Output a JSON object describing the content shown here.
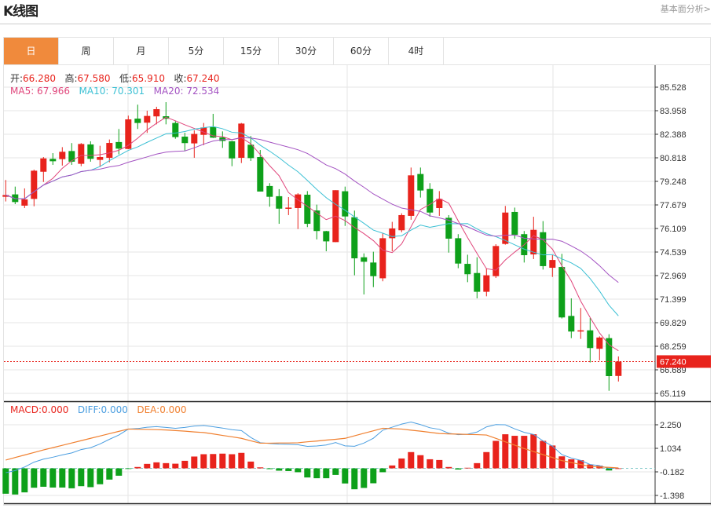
{
  "header": {
    "title": "K线图",
    "link": "基本面分析>"
  },
  "tabs": [
    {
      "label": "日",
      "active": true
    },
    {
      "label": "周"
    },
    {
      "label": "月"
    },
    {
      "label": "5分"
    },
    {
      "label": "15分"
    },
    {
      "label": "30分"
    },
    {
      "label": "60分"
    },
    {
      "label": "4时"
    }
  ],
  "ohlc_legend": {
    "open_label": "开:",
    "open": "66.280",
    "high_label": "高:",
    "high": "67.580",
    "low_label": "低:",
    "low": "65.910",
    "close_label": "收:",
    "close": "67.240"
  },
  "ma_legend": {
    "ma5": "MA5: 67.966",
    "ma10": "MA10: 70.301",
    "ma20": "MA20: 72.534"
  },
  "macd_legend": {
    "macd": "MACD:0.000",
    "diff": "DIFF:0.000",
    "dea": "DEA:0.000"
  },
  "colors": {
    "up": "#e8231c",
    "down": "#0ea01a",
    "ma5": "#e0457b",
    "ma10": "#3cc0d4",
    "ma20": "#a352c2",
    "diff": "#4b9ee0",
    "dea": "#f08030",
    "accent": "#f08a3c"
  },
  "chart_data": [
    {
      "type": "candlestick",
      "price_ticks": [
        "85.528",
        "83.958",
        "82.388",
        "80.818",
        "79.248",
        "77.679",
        "76.109",
        "74.539",
        "72.969",
        "71.399",
        "69.829",
        "68.259",
        "66.689",
        "65.119"
      ],
      "ylim": [
        65.119,
        85.528
      ],
      "current_price": "67.240",
      "candles": [
        [
          78.22,
          79.34,
          77.91,
          78.34
        ],
        [
          78.38,
          78.9,
          77.73,
          77.87
        ],
        [
          77.63,
          78.78,
          77.47,
          78.05
        ],
        [
          78.08,
          80.03,
          77.59,
          79.96
        ],
        [
          79.89,
          80.87,
          79.21,
          80.78
        ],
        [
          80.75,
          81.13,
          80.35,
          80.59
        ],
        [
          80.73,
          81.53,
          80.3,
          81.22
        ],
        [
          81.27,
          81.8,
          80.35,
          80.56
        ],
        [
          80.42,
          81.8,
          80.26,
          81.74
        ],
        [
          81.71,
          81.92,
          80.56,
          80.75
        ],
        [
          80.68,
          81.62,
          80.21,
          80.87
        ],
        [
          80.82,
          82.04,
          80.52,
          81.81
        ],
        [
          81.87,
          82.74,
          81.05,
          81.43
        ],
        [
          81.41,
          83.63,
          81.39,
          83.38
        ],
        [
          83.43,
          84.36,
          82.74,
          83.14
        ],
        [
          83.16,
          83.96,
          82.48,
          83.61
        ],
        [
          83.58,
          84.22,
          83.05,
          84.06
        ],
        [
          83.59,
          84.53,
          83.05,
          83.42
        ],
        [
          83.14,
          83.26,
          82.09,
          82.2
        ],
        [
          82.23,
          82.49,
          81.27,
          81.8
        ],
        [
          81.78,
          82.65,
          80.82,
          82.41
        ],
        [
          82.35,
          83.14,
          81.66,
          82.84
        ],
        [
          82.86,
          83.75,
          82.14,
          82.16
        ],
        [
          82.18,
          82.58,
          81.48,
          81.94
        ],
        [
          81.92,
          81.95,
          80.26,
          80.78
        ],
        [
          80.82,
          83.14,
          80.47,
          83.1
        ],
        [
          81.69,
          82.27,
          80.61,
          80.8
        ],
        [
          80.87,
          81.34,
          78.57,
          78.57
        ],
        [
          78.94,
          79.13,
          77.56,
          78.22
        ],
        [
          78.26,
          78.73,
          76.42,
          77.43
        ],
        [
          77.42,
          78.2,
          77.0,
          77.5
        ],
        [
          77.47,
          78.46,
          76.07,
          78.38
        ],
        [
          78.36,
          78.6,
          76.2,
          76.42
        ],
        [
          77.31,
          77.7,
          75.38,
          75.94
        ],
        [
          75.93,
          75.95,
          74.59,
          75.25
        ],
        [
          75.2,
          78.66,
          75.2,
          78.66
        ],
        [
          78.59,
          78.9,
          76.28,
          76.91
        ],
        [
          76.86,
          77.3,
          72.99,
          74.12
        ],
        [
          74.19,
          74.45,
          71.71,
          73.89
        ],
        [
          73.84,
          74.56,
          72.2,
          72.93
        ],
        [
          72.79,
          75.81,
          72.59,
          75.46
        ],
        [
          75.46,
          76.55,
          74.59,
          76.11
        ],
        [
          75.99,
          77.12,
          75.86,
          77.0
        ],
        [
          76.95,
          80.17,
          76.69,
          79.65
        ],
        [
          79.74,
          80.17,
          78.17,
          78.64
        ],
        [
          78.74,
          79.13,
          76.89,
          77.17
        ],
        [
          77.47,
          78.6,
          76.95,
          78.08
        ],
        [
          76.82,
          77.0,
          74.5,
          75.43
        ],
        [
          75.46,
          75.73,
          73.46,
          73.77
        ],
        [
          73.75,
          74.36,
          72.53,
          73.06
        ],
        [
          73.14,
          74.19,
          71.45,
          71.89
        ],
        [
          71.89,
          73.46,
          71.59,
          72.99
        ],
        [
          72.93,
          75.06,
          72.81,
          74.94
        ],
        [
          75.08,
          77.61,
          75.03,
          77.17
        ],
        [
          77.21,
          77.5,
          75.43,
          75.69
        ],
        [
          75.73,
          75.94,
          73.84,
          74.33
        ],
        [
          74.38,
          76.89,
          74.07,
          76.02
        ],
        [
          75.86,
          76.6,
          73.37,
          73.6
        ],
        [
          73.49,
          74.33,
          72.88,
          74.01
        ],
        [
          73.54,
          74.42,
          70.11,
          70.18
        ],
        [
          70.28,
          71.45,
          68.8,
          69.24
        ],
        [
          69.24,
          70.81,
          68.75,
          69.32
        ],
        [
          69.32,
          70.14,
          67.18,
          68.14
        ],
        [
          68.09,
          68.92,
          67.32,
          68.84
        ],
        [
          68.8,
          69.06,
          65.29,
          66.27
        ],
        [
          66.28,
          67.58,
          65.91,
          67.24
        ]
      ],
      "moving_averages": [
        5,
        10,
        20
      ]
    },
    {
      "type": "macd",
      "ticks": [
        "2.250",
        "1.034",
        "-0.182",
        "-1.398"
      ],
      "ylim": [
        -1.398,
        2.25
      ],
      "macd": [
        -1.31,
        -1.35,
        -1.24,
        -1.0,
        -0.95,
        -0.99,
        -0.99,
        -1.03,
        -0.92,
        -0.97,
        -0.82,
        -0.58,
        -0.38,
        -0.01,
        0.07,
        0.23,
        0.31,
        0.27,
        0.24,
        0.39,
        0.61,
        0.73,
        0.74,
        0.76,
        0.73,
        0.8,
        0.35,
        0.05,
        -0.04,
        -0.12,
        -0.14,
        -0.2,
        -0.47,
        -0.51,
        -0.51,
        -0.34,
        -0.78,
        -1.08,
        -1.01,
        -0.77,
        -0.2,
        0.15,
        0.51,
        0.84,
        0.68,
        0.47,
        0.43,
        0.07,
        -0.06,
        0.03,
        0.27,
        0.84,
        1.42,
        1.76,
        1.68,
        1.68,
        1.76,
        1.42,
        1.18,
        0.62,
        0.47,
        0.42,
        0.2,
        0.14,
        -0.11,
        0.0
      ],
      "dea": [
        0.43,
        0.56,
        0.69,
        0.82,
        0.95,
        1.07,
        1.19,
        1.31,
        1.43,
        1.55,
        1.67,
        1.79,
        1.91,
        2.03,
        2.02,
        2.01,
        2.0,
        1.98,
        1.95,
        1.92,
        1.88,
        1.85,
        1.78,
        1.7,
        1.63,
        1.55,
        1.42,
        1.3,
        1.3,
        1.31,
        1.31,
        1.32,
        1.37,
        1.41,
        1.46,
        1.5,
        1.55,
        1.68,
        1.81,
        1.94,
        2.07,
        2.05,
        2.03,
        1.97,
        1.92,
        1.86,
        1.8,
        1.78,
        1.77,
        1.75,
        1.74,
        1.72,
        1.55,
        1.37,
        1.2,
        1.02,
        0.87,
        0.71,
        0.56,
        0.4,
        0.3,
        0.2,
        0.1,
        0.07,
        0.05,
        0.02
      ]
    }
  ]
}
